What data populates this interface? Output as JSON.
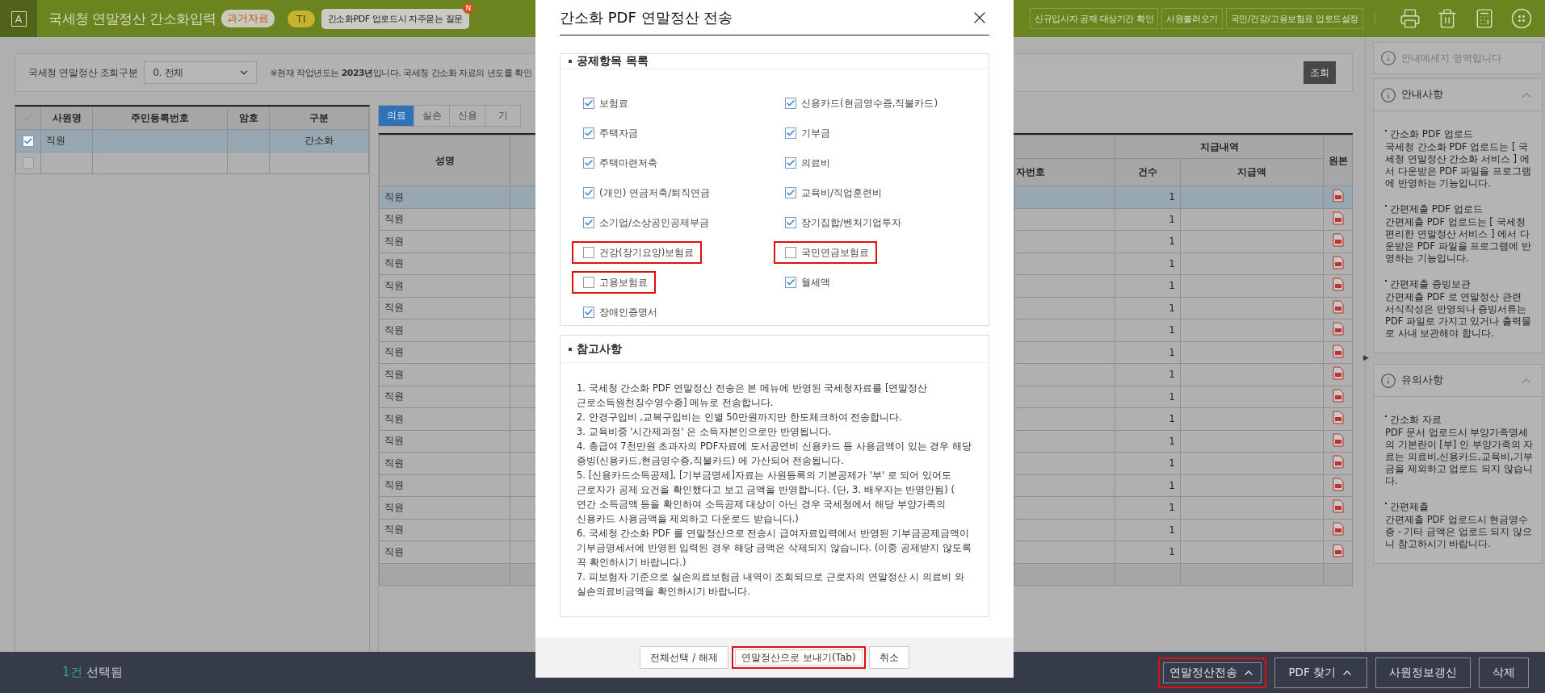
{
  "app": {
    "logo": "A",
    "title": "국세청 연말정산 간소화입력",
    "badge": "과거자료",
    "user": "TI",
    "faq": "간소화PDF 업로드시 자주묻는 질문",
    "faq_badge": "N",
    "actions": [
      "신규입사자 공제 대상기간 확인",
      "사원불러오기",
      "국민/건강/고용보험료 업로드설정"
    ]
  },
  "filter": {
    "label": "국세청 연말정산 조회구분",
    "value": "0. 전체",
    "notice": "※현재 작업년도는 **2023년**입니다. 국세청 간소화 자료의 년도를 확인",
    "search_button": "조회"
  },
  "employees": {
    "columns": [
      "사원명",
      "주민등록번호",
      "암호",
      "구분"
    ],
    "rows": [
      {
        "checked": true,
        "selected": true,
        "name": "직원",
        "type": "간소화"
      },
      {
        "checked": false,
        "selected": false
      }
    ]
  },
  "detail": {
    "tabs": [
      {
        "label": "의료",
        "selected": true
      },
      {
        "label": "실손",
        "selected": false
      },
      {
        "label": "신용",
        "selected": false
      },
      {
        "label": "기",
        "selected": false
      }
    ],
    "columns": {
      "name": "성명",
      "column_3": "자번호",
      "group": "지급내역",
      "count": "건수",
      "amount": "지급액",
      "original": "원본"
    },
    "rows": [
      {
        "name": "직원",
        "count": "1",
        "selected": true
      },
      {
        "name": "직원",
        "count": "1",
        "selected": false
      },
      {
        "name": "직원",
        "count": "1",
        "selected": false
      },
      {
        "name": "직원",
        "count": "1",
        "selected": false
      },
      {
        "name": "직원",
        "count": "1",
        "selected": false
      },
      {
        "name": "직원",
        "count": "1",
        "selected": false
      },
      {
        "name": "직원",
        "count": "1",
        "selected": false
      },
      {
        "name": "직원",
        "count": "1",
        "selected": false
      },
      {
        "name": "직원",
        "count": "1",
        "selected": false
      },
      {
        "name": "직원",
        "count": "1",
        "selected": false
      },
      {
        "name": "직원",
        "count": "1",
        "selected": false
      },
      {
        "name": "직원",
        "count": "1",
        "selected": false
      },
      {
        "name": "직원",
        "count": "1",
        "selected": false
      },
      {
        "name": "직원",
        "count": "1",
        "selected": false
      },
      {
        "name": "직원",
        "count": "1",
        "selected": false
      },
      {
        "name": "직원",
        "count": "1",
        "selected": false
      },
      {
        "name": "직원",
        "count": "1",
        "selected": false
      }
    ]
  },
  "sidebar": {
    "handle": "▶",
    "message": "안내메세지 영역입니다",
    "panels": [
      {
        "title": "안내사항",
        "expanded": true,
        "sections": [
          {
            "heading": "간소화 PDF 업로드",
            "text": "국세청 간소화 PDF 업로드는 [ 국세청 연말정산 간소화 서비스 ] 에서 다운받은 PDF 파일을 프로그램에 반영하는 기능입니다."
          },
          {
            "heading": "간편제출 PDF 업로드",
            "text": "간편제출 PDF 업로드는 [ 국세청 편리한 연말정산 서비스 ] 에서 다운받은 PDF 파일을 프로그램에 반영하는 기능입니다."
          },
          {
            "heading": "간편제출 증빙보관",
            "text": "간편제출 PDF 로 연말정산 관련 서식작성은 반영되나 증빙서류는 PDF 파일로 가지고 있거나 출력물로 사내 보관해야 합니다."
          }
        ]
      },
      {
        "title": "유의사항",
        "expanded": true,
        "sections": [
          {
            "heading": "간소화 자료",
            "text": "PDF 문서 업로드시 부양가족명세의 기본란이 [부] 인 부양가족의 자료는 의료비,신용카드,교육비,기부금을 제외하고 업로드 되지 않습니다."
          },
          {
            "heading": "간편제출",
            "text": "간편제출 PDF 업로드시 현금영수증 - 기타 금액은  업로드 되지 않으니 참고하시기 바랍니다."
          }
        ]
      }
    ]
  },
  "modal": {
    "title": "간소화 PDF 연말정산 전송",
    "section_title": "공제항목 목록",
    "items": [
      {
        "label": "보험료",
        "checked": true,
        "highlighted": false
      },
      {
        "label": "신용카드(현금영수증,직불카드)",
        "checked": true,
        "highlighted": false
      },
      {
        "label": "주택자금",
        "checked": true,
        "highlighted": false
      },
      {
        "label": "기부금",
        "checked": true,
        "highlighted": false
      },
      {
        "label": "주택마련저축",
        "checked": true,
        "highlighted": false
      },
      {
        "label": "의료비",
        "checked": true,
        "highlighted": false
      },
      {
        "label": "(개인) 연금저축/퇴직연금",
        "checked": true,
        "highlighted": false
      },
      {
        "label": "교육비/직업훈련비",
        "checked": true,
        "highlighted": false
      },
      {
        "label": "소기업/소상공인공제부금",
        "checked": true,
        "highlighted": false
      },
      {
        "label": "장기집합/벤처기업투자",
        "checked": true,
        "highlighted": false
      },
      {
        "label": "건강(장기요양)보험료",
        "checked": false,
        "highlighted": true
      },
      {
        "label": "국민연금보험료",
        "checked": false,
        "highlighted": true
      },
      {
        "label": "고용보험료",
        "checked": false,
        "highlighted": true
      },
      {
        "label": "월세액",
        "checked": true,
        "highlighted": false
      },
      {
        "label": "장애인증명서",
        "checked": true,
        "highlighted": false
      }
    ],
    "notes_title": "참고사항",
    "notes": [
      "1. 국세청 간소화 PDF 연말정산 전송은 본 메뉴에 반영된 국세청자료를 [연말정산 근로소득원천징수영수증] 메뉴로 전송합니다.",
      "2. 안경구입비 ,교복구입비는 인별 50만원까지만 한도체크하여 전송합니다.",
      "3. 교육비중 '시간제과정' 은 소득자본인으로만 반영됩니다.",
      "4. 총급여 7천만원 초과자의 PDF자료에 도서공연비 신용카드 등 사용금액이 있는 경우 해당 증빙(신용카드,현금영수증,직불카드) 에 가산되어 전송됩니다.",
      "5. [신용카드소득공제], [기부금명세]자료는 사원등록의 기본공제가 '부' 로 되어 있어도 근로자가 공제 요건을 확인했다고 보고 금액을 반영합니다. (단, 3. 배우자는 반영안됨) ( 연간 소득금액 등을 확인하여 소득공제 대상이 아닌 경우 국세청에서 해당 부양가족의 신용카드 사용금액을 제외하고 다운로드 받습니다.)",
      "6. 국세청 간소화 PDF 를 연말정산으로 전송시 급여자료입력에서 반영된 기부금공제금액이 기부금명세서에 반영된 입력된 경우 해당 금액은 삭제되지 않습니다. (이중 공제받지 않도록 꼭 확인하시기 바랍니다.)",
      "7. 피보험자 기준으로 실손의료보험금 내역이 조회되므로 근로자의 연말정산 시 의료비 와 실손의료비금액을 확인하시기 바랍니다."
    ],
    "buttons": [
      {
        "label": "전체선택 / 해제",
        "highlighted": false
      },
      {
        "label": "연말정산으로 보내기(Tab)",
        "highlighted": true
      },
      {
        "label": "취소",
        "highlighted": false
      }
    ]
  },
  "bottom": {
    "count": "1건",
    "label": "선택됨",
    "buttons": [
      {
        "label": "연말정산전송",
        "menu": true,
        "highlighted": true
      },
      {
        "label": "PDF 찾기",
        "menu": true,
        "highlighted": false
      },
      {
        "label": "사원정보갱신",
        "menu": false,
        "highlighted": false
      },
      {
        "label": "삭제",
        "menu": false,
        "highlighted": false
      }
    ]
  }
}
